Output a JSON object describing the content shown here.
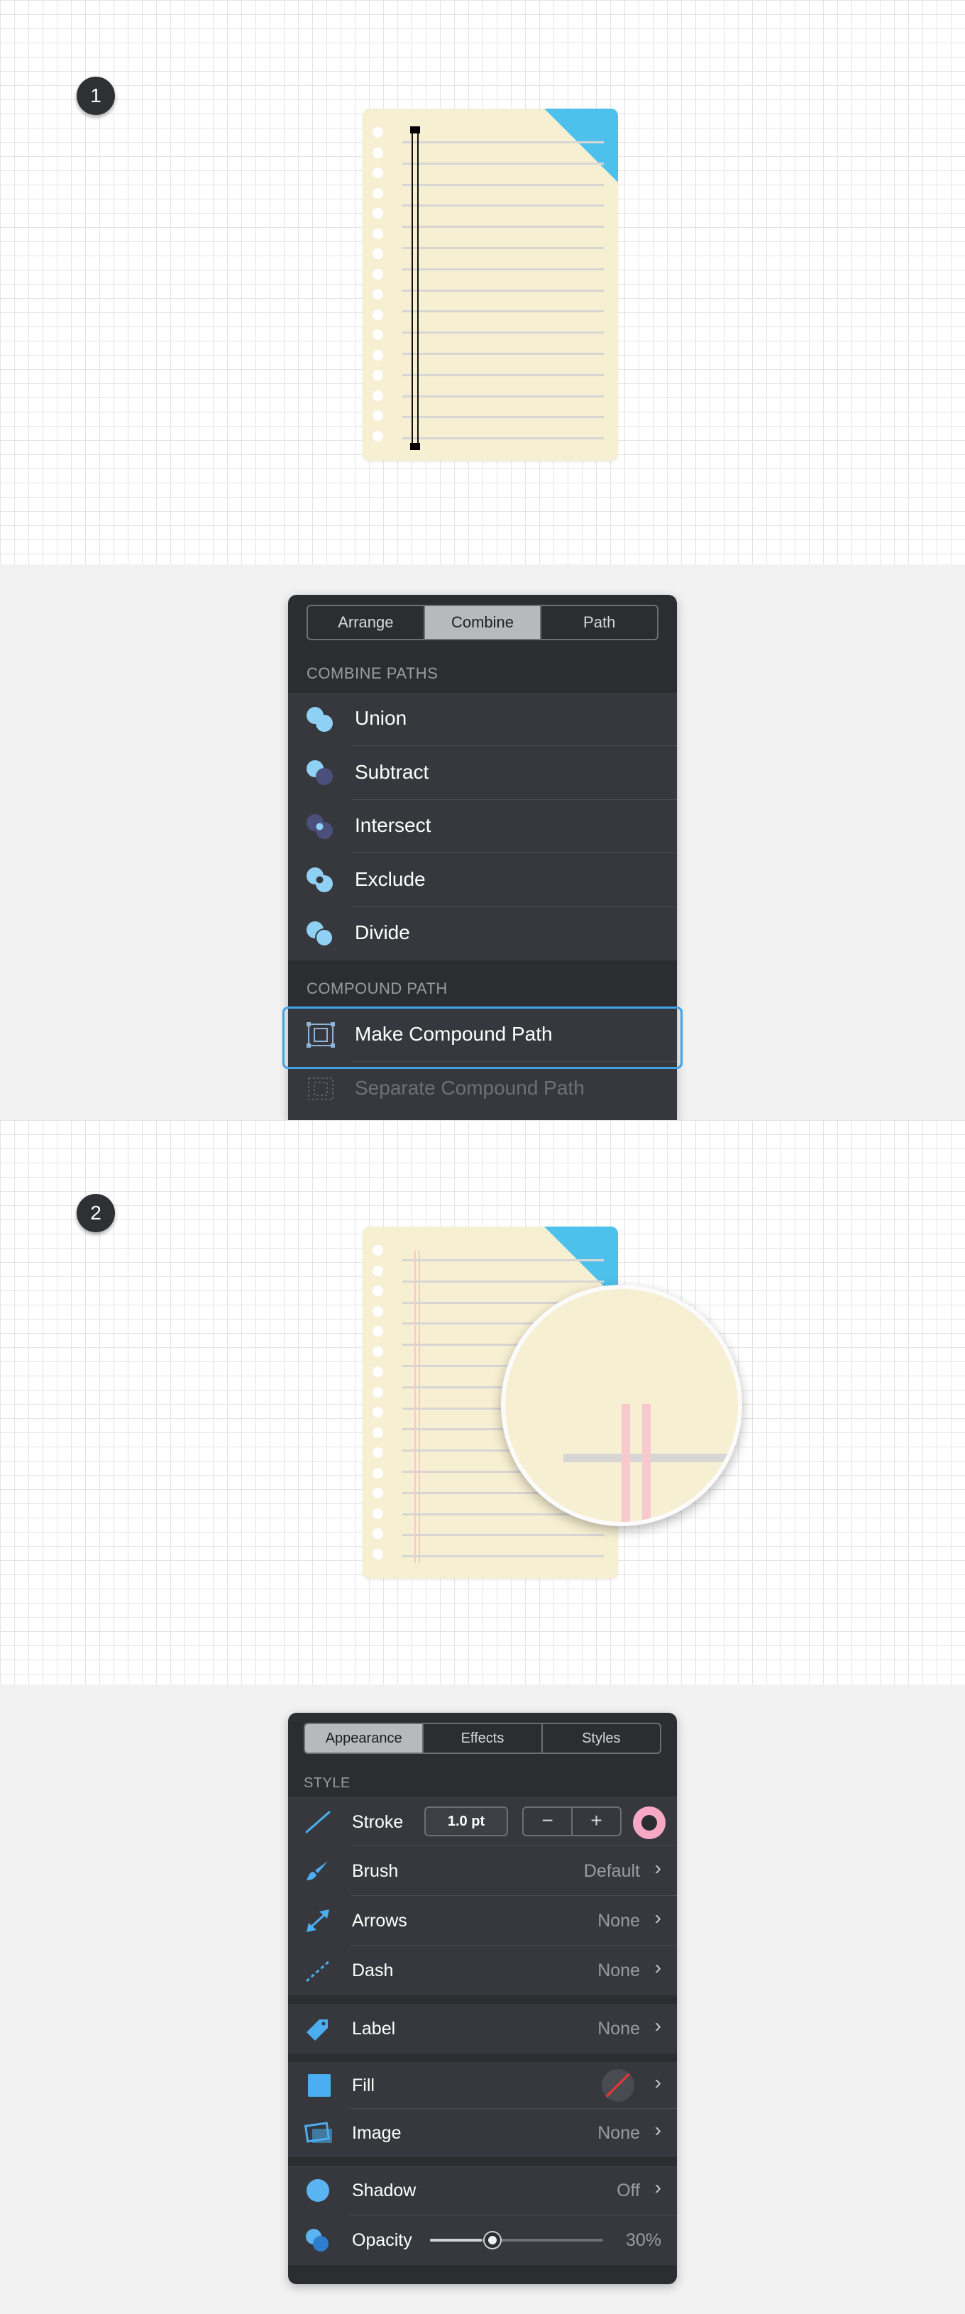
{
  "step1": {
    "badge": "1"
  },
  "combine_panel": {
    "tabs": [
      {
        "label": "Arrange"
      },
      {
        "label": "Combine"
      },
      {
        "label": "Path"
      }
    ],
    "combine_header": "COMBINE PATHS",
    "combine_items": [
      {
        "label": "Union",
        "icon": "union-icon"
      },
      {
        "label": "Subtract",
        "icon": "subtract-icon"
      },
      {
        "label": "Intersect",
        "icon": "intersect-icon"
      },
      {
        "label": "Exclude",
        "icon": "exclude-icon"
      },
      {
        "label": "Divide",
        "icon": "divide-icon"
      }
    ],
    "compound_header": "COMPOUND PATH",
    "make_compound": "Make Compound Path",
    "separate_compound": "Separate Compound Path",
    "selected_color": "#3fa3e8"
  },
  "step2": {
    "badge": "2"
  },
  "appearance_panel": {
    "tabs": [
      {
        "label": "Appearance"
      },
      {
        "label": "Effects"
      },
      {
        "label": "Styles"
      }
    ],
    "style_header": "STYLE",
    "stroke": {
      "label": "Stroke",
      "value": "1.0 pt",
      "minus": "−",
      "plus": "+",
      "color": "#f7a8c4"
    },
    "brush": {
      "label": "Brush",
      "value": "Default"
    },
    "arrows": {
      "label": "Arrows",
      "value": "None"
    },
    "dash": {
      "label": "Dash",
      "value": "None"
    },
    "label": {
      "label": "Label",
      "value": "None"
    },
    "fill": {
      "label": "Fill"
    },
    "image": {
      "label": "Image",
      "value": "None"
    },
    "shadow": {
      "label": "Shadow",
      "value": "Off"
    },
    "opacity": {
      "label": "Opacity",
      "value": "30%",
      "level": 0.3
    },
    "chevron": "›"
  },
  "colors": {
    "accent_blue": "#4dc1ec",
    "paper": "#f7efd2",
    "panel_bg": "#2c2d31",
    "margin_line_pink": "#f6c9c9"
  }
}
